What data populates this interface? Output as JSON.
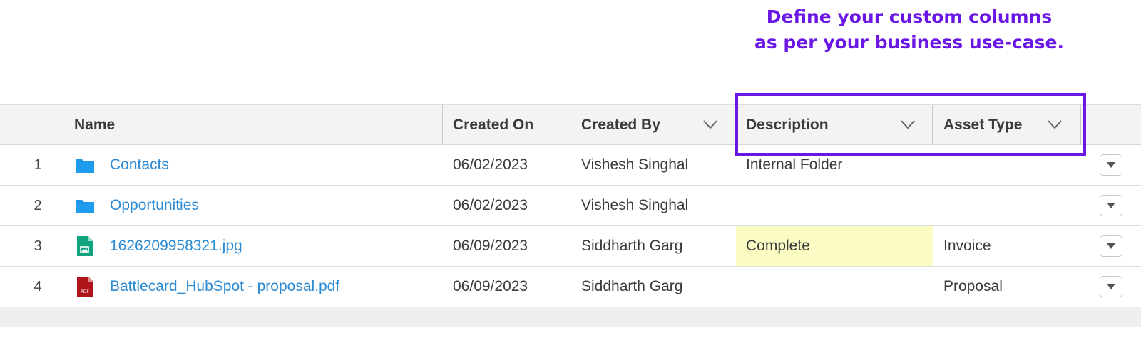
{
  "callout": {
    "line1": "Define your custom columns",
    "line2": "as per your business use-case."
  },
  "columns": {
    "name": "Name",
    "created_on": "Created On",
    "created_by": "Created By",
    "description": "Description",
    "asset_type": "Asset Type"
  },
  "rows": [
    {
      "num": "1",
      "icon": "folder-icon",
      "name": "Contacts",
      "created_on": "06/02/2023",
      "created_by": "Vishesh Singhal",
      "description": "Internal Folder",
      "asset_type": ""
    },
    {
      "num": "2",
      "icon": "folder-icon",
      "name": "Opportunities",
      "created_on": "06/02/2023",
      "created_by": "Vishesh Singhal",
      "description": "",
      "asset_type": ""
    },
    {
      "num": "3",
      "icon": "image-file-icon",
      "name": "1626209958321.jpg",
      "created_on": "06/09/2023",
      "created_by": "Siddharth Garg",
      "description": "Complete",
      "asset_type": "Invoice"
    },
    {
      "num": "4",
      "icon": "pdf-file-icon",
      "name": "Battlecard_HubSpot - proposal.pdf",
      "created_on": "06/09/2023",
      "created_by": "Siddharth Garg",
      "description": "",
      "asset_type": "Proposal"
    }
  ],
  "colors": {
    "callout": "#6a17e6",
    "link": "#2a8ad4",
    "highlight_cell": "#fbfcc4",
    "folder": "#1b96e8",
    "image_file": "#0fa37f",
    "pdf_file": "#b0141b"
  },
  "pdf_icon_text": "PDF"
}
